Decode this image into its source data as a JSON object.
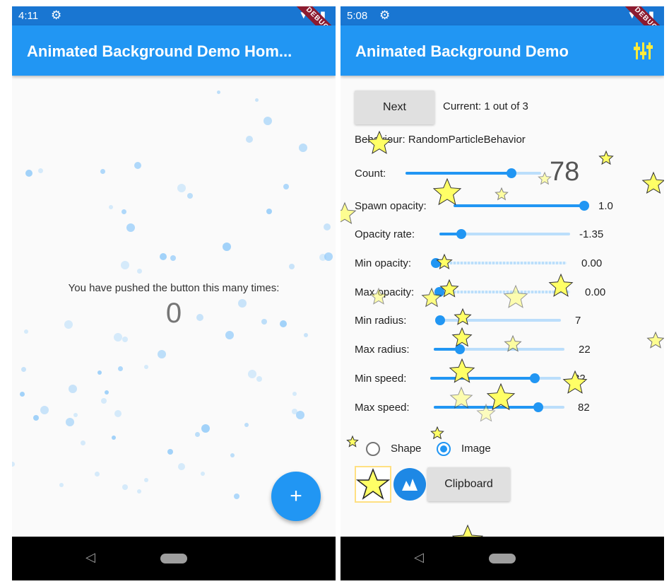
{
  "left": {
    "status": {
      "time": "4:11"
    },
    "appbar": {
      "title": "Animated Background Demo Hom..."
    },
    "body": {
      "counter_text": "You have pushed the button this many times:",
      "counter_value": "0"
    },
    "fab": {
      "label": "+"
    }
  },
  "right": {
    "status": {
      "time": "5:08"
    },
    "appbar": {
      "title": "Animated Background Demo"
    },
    "controls": {
      "next_label": "Next",
      "current_text": "Current: 1 out of 3",
      "behaviour_text": "Behaviour: RandomParticleBehavior",
      "count_label": "Count:",
      "count_value": "78",
      "count_level": 0.78,
      "sliders": [
        {
          "label": "Spawn opacity:",
          "value": "1.0",
          "level": 1.0
        },
        {
          "label": "Opacity rate:",
          "value": "-1.35",
          "level": 0.17
        },
        {
          "label": "Min opacity:",
          "value": "0.00",
          "level": 0.0
        },
        {
          "label": "Max opacity:",
          "value": "0.00",
          "level": 0.0
        },
        {
          "label": "Min radius:",
          "value": "7",
          "level": 0.02
        },
        {
          "label": "Max radius:",
          "value": "22",
          "level": 0.2
        },
        {
          "label": "Min speed:",
          "value": "82",
          "level": 0.8
        },
        {
          "label": "Max speed:",
          "value": "82",
          "level": 0.8
        }
      ],
      "radio_shape": "Shape",
      "radio_image": "Image",
      "clipboard_label": "Clipboard"
    }
  },
  "nav": {
    "back_icon": "◁"
  },
  "colors": {
    "appbar": "#2196f3",
    "statusbar": "#1976d2",
    "accent": "#2196f3",
    "star": "#ffff66"
  },
  "icons": [
    "settings-icon",
    "wifi-icon",
    "signal-icon",
    "battery-icon",
    "back-icon",
    "home-icon",
    "plus-icon",
    "star-icon",
    "image-icon",
    "tune-icon"
  ]
}
